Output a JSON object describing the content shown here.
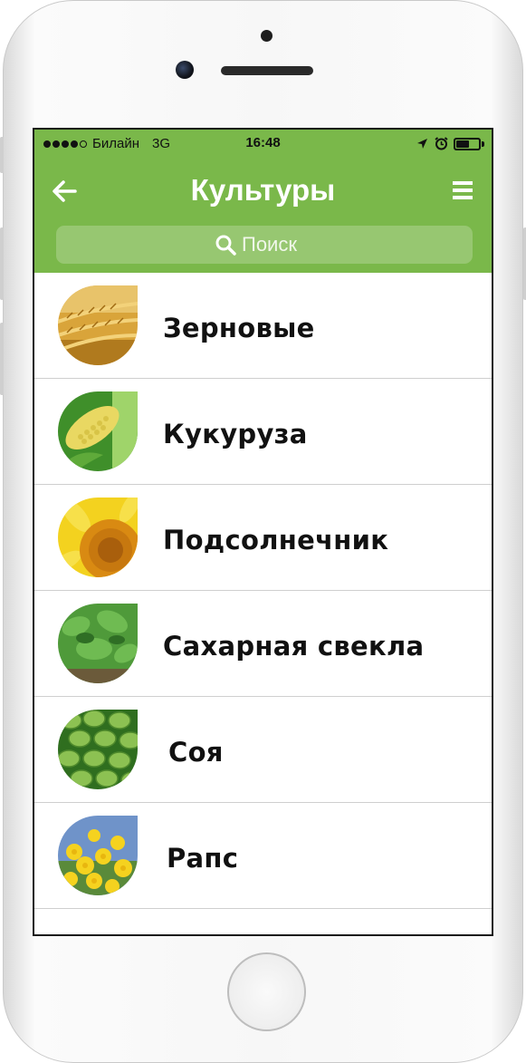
{
  "status_bar": {
    "carrier": "Билайн",
    "network": "3G",
    "time": "16:48",
    "battery_level": 0.55
  },
  "header": {
    "title": "Культуры",
    "back_icon": "arrow-left-icon",
    "menu_icon": "hamburger-menu-icon"
  },
  "search": {
    "placeholder": "Поиск",
    "icon": "search-icon"
  },
  "colors": {
    "header_green": "#7ab84a",
    "text": "#111111",
    "divider": "#cfcfcf"
  },
  "crops": [
    {
      "label": "Зерновые",
      "image": "wheat-image"
    },
    {
      "label": "Кукуруза",
      "image": "corn-image"
    },
    {
      "label": "Подсолнечник",
      "image": "sunflower-image"
    },
    {
      "label": "Сахарная свекла",
      "image": "sugar-beet-image"
    },
    {
      "label": "Соя",
      "image": "soybean-image"
    },
    {
      "label": "Рапс",
      "image": "rapeseed-image"
    }
  ]
}
